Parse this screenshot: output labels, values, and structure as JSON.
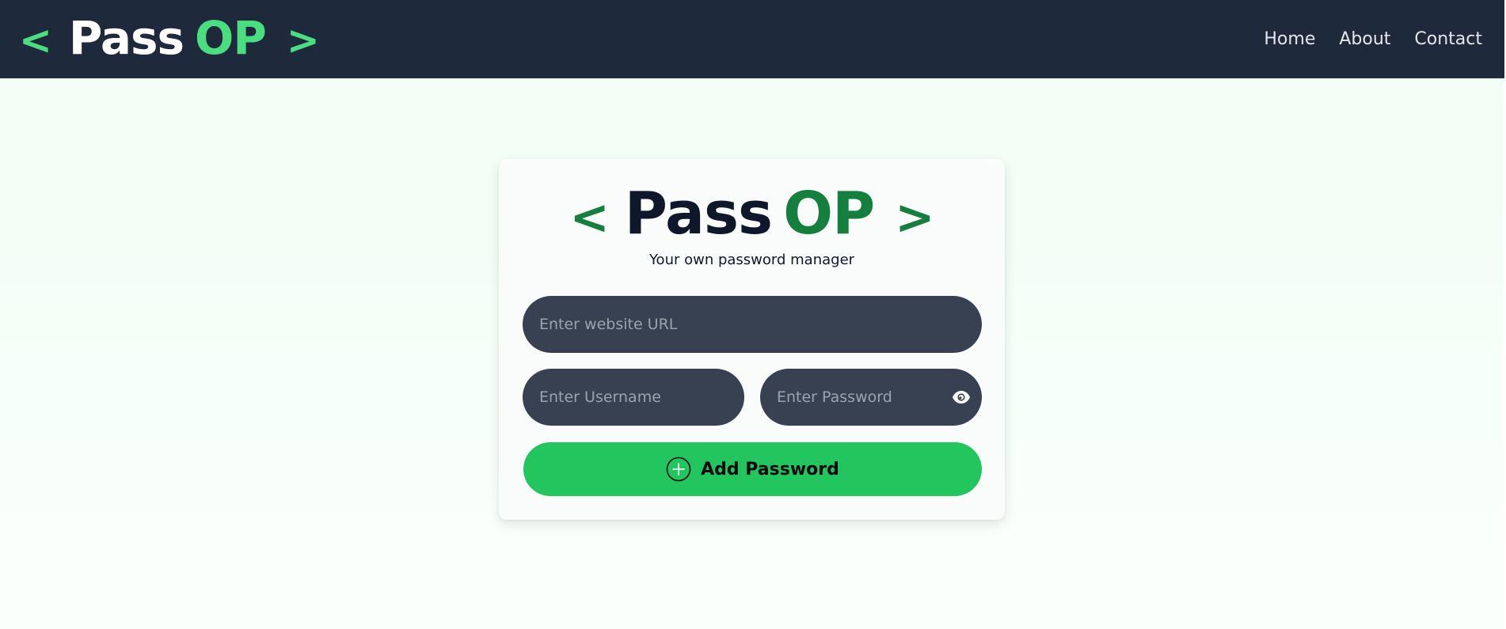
{
  "navbar": {
    "logo": {
      "open_bracket": "<",
      "pass": "Pass",
      "op": "OP",
      "close_bracket": ">"
    },
    "links": [
      {
        "label": "Home"
      },
      {
        "label": "About"
      },
      {
        "label": "Contact"
      }
    ],
    "colors": {
      "background": "#1e293b",
      "accent": "#4ade80"
    }
  },
  "card": {
    "logo": {
      "open_bracket": "<",
      "pass": "Pass",
      "op": "OP",
      "close_bracket": ">"
    },
    "tagline": "Your own password manager",
    "url_field": {
      "value": "",
      "placeholder": "Enter website URL"
    },
    "username_field": {
      "value": "",
      "placeholder": "Enter Username"
    },
    "password_field": {
      "value": "",
      "placeholder": "Enter Password",
      "toggle_icon": "eye-icon"
    },
    "add_button": {
      "label": "Add Password",
      "icon": "plus-circle-icon"
    },
    "colors": {
      "accent": "#15803d",
      "button": "#22c55e",
      "field": "#374151"
    }
  }
}
